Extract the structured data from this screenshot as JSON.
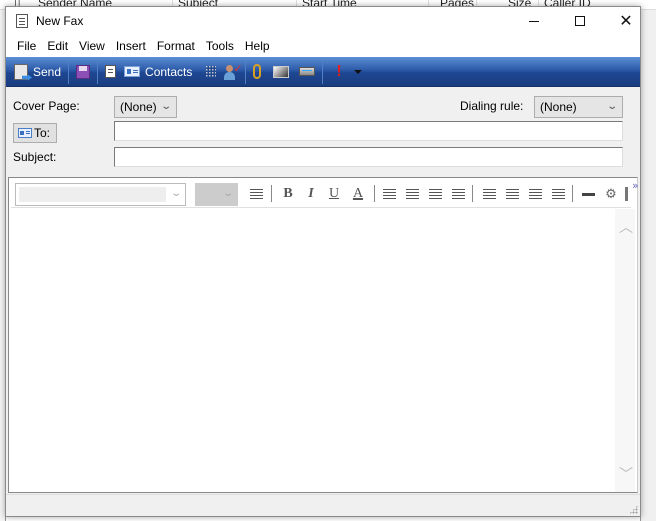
{
  "background_window": {
    "columns": [
      "Sender Name",
      "Subject",
      "Start Time",
      "Pages",
      "Size",
      "Caller ID"
    ]
  },
  "window": {
    "title": "New Fax",
    "icon": "fax-document-icon",
    "controls": {
      "minimize": "minimize-icon",
      "maximize": "maximize-icon",
      "close": "close-icon"
    }
  },
  "menu": {
    "items": [
      "File",
      "Edit",
      "View",
      "Insert",
      "Format",
      "Tools",
      "Help"
    ]
  },
  "toolbar": {
    "send_label": "Send",
    "contacts_label": "Contacts",
    "accent_color": "#1e4691",
    "icons": [
      "send-icon",
      "save-icon",
      "cover-page-icon",
      "contacts-icon",
      "dial-pad-icon",
      "check-names-icon",
      "attach-icon",
      "insert-picture-icon",
      "scan-icon",
      "priority-icon",
      "dropdown-arrow-icon"
    ]
  },
  "form": {
    "cover_page_label": "Cover Page:",
    "cover_page_value": "(None)",
    "dialing_rule_label": "Dialing rule:",
    "dialing_rule_value": "(None)",
    "to_label": "To:",
    "to_value": "",
    "subject_label": "Subject:",
    "subject_value": ""
  },
  "format_toolbar": {
    "font_value": "",
    "size_value": "",
    "bold": "B",
    "italic": "I",
    "underline": "U",
    "font_color": "A",
    "overflow": "»"
  },
  "editor": {
    "body_text": ""
  }
}
